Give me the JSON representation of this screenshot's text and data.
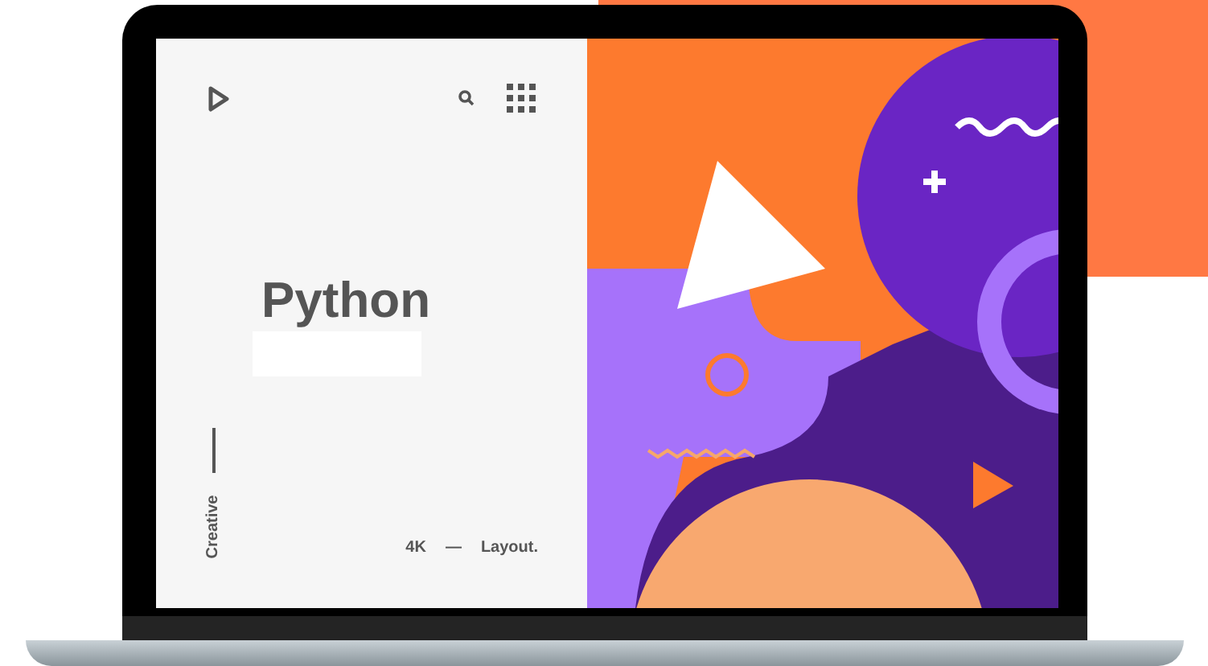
{
  "page": {
    "title": "Python",
    "side_label": "Creative",
    "footer": [
      "4K",
      "—",
      "Layout."
    ]
  }
}
